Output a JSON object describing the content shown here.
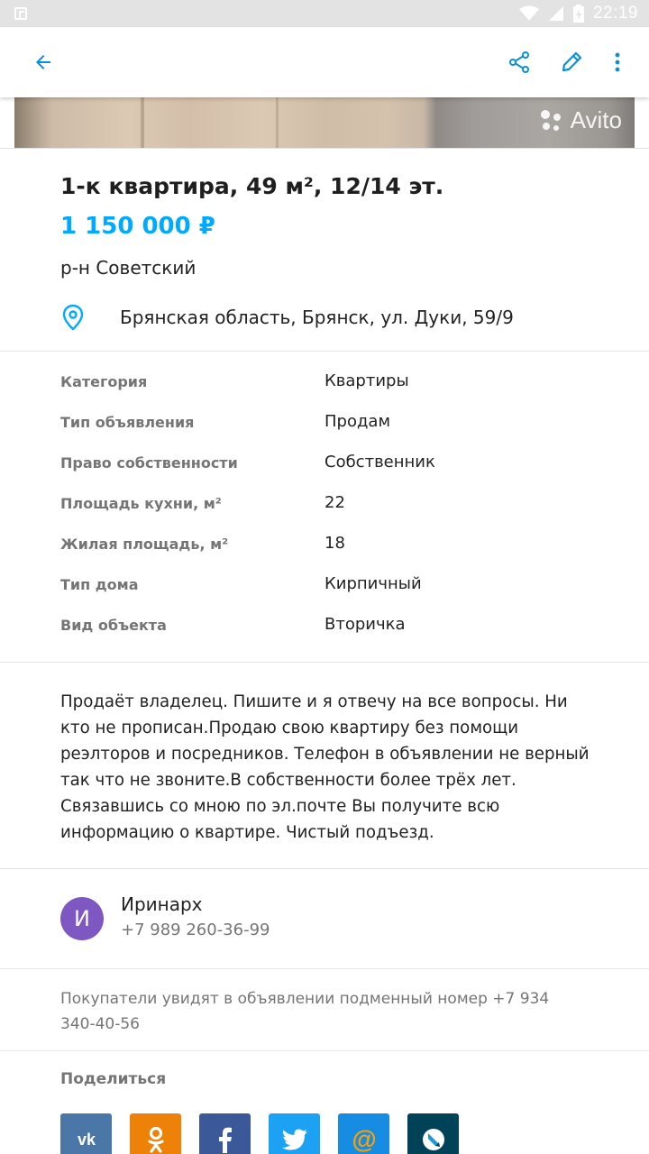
{
  "status_bar": {
    "time": "22:19"
  },
  "photo": {
    "watermark": "Avito"
  },
  "listing": {
    "title": "1-к квартира, 49 м², 12/14 эт.",
    "price": "1 150 000 ₽",
    "district": "р-н Советский",
    "address": "Брянская область, Брянск, ул. Дуки, 59/9"
  },
  "params": [
    {
      "key": "Категория",
      "value": "Квартиры"
    },
    {
      "key": "Тип объявления",
      "value": "Продам"
    },
    {
      "key": "Право собственности",
      "value": "Собственник"
    },
    {
      "key": "Площадь кухни, м²",
      "value": "22"
    },
    {
      "key": "Жилая площадь, м²",
      "value": "18"
    },
    {
      "key": "Тип дома",
      "value": "Кирпичный"
    },
    {
      "key": "Вид объекта",
      "value": "Вторичка"
    }
  ],
  "description": "Продаёт владелец. Пишите и я отвечу на все вопросы. Ни кто не прописан.Продаю свою квартиру без помощи реэлторов и посредников. Телефон в объявлении не верный так что не звоните.В собственности более трёх лет. Связавшись со мною по эл.почте Вы получите всю информацию о квартире. Чистый подъезд.",
  "seller": {
    "avatar_letter": "И",
    "name": "Иринарх",
    "phone": "+7 989 260-36-99",
    "avatar_color": "#7e57c2"
  },
  "note": "Покупатели увидят в объявлении подменный номер +7 934 340-40-56",
  "share": {
    "title": "Поделиться",
    "buttons": [
      {
        "icon": "vk-icon",
        "glyph": "vk",
        "color": "#4a76a8"
      },
      {
        "icon": "odnoklassniki-icon",
        "glyph": "ok",
        "color": "#ee8208"
      },
      {
        "icon": "facebook-icon",
        "glyph": "f",
        "color": "#3b5998"
      },
      {
        "icon": "twitter-icon",
        "glyph": "tw",
        "color": "#1da1f2"
      },
      {
        "icon": "mailru-icon",
        "glyph": "@",
        "color": "#168de2"
      },
      {
        "icon": "livejournal-icon",
        "glyph": "lj",
        "color": "#004359"
      }
    ]
  },
  "colors": {
    "accent": "#00aaff",
    "muted": "#757575"
  }
}
